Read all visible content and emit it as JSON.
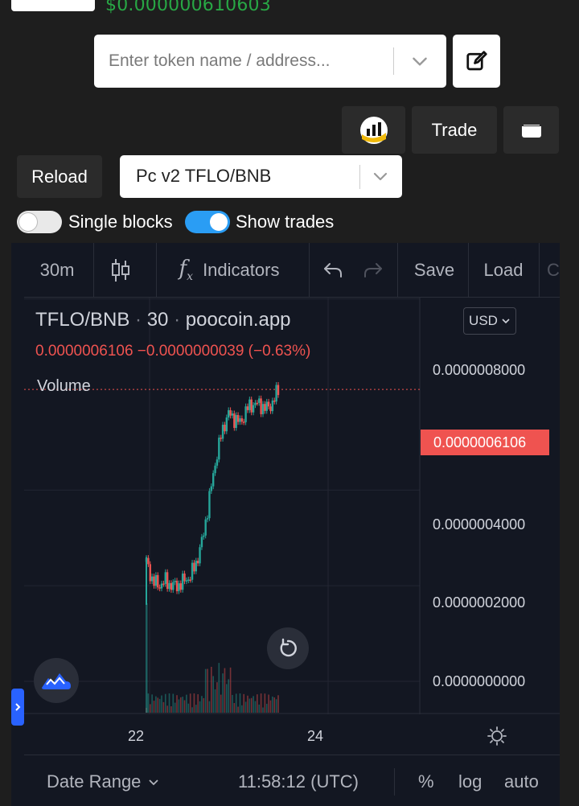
{
  "header": {
    "price": "$0.000000610603"
  },
  "search": {
    "placeholder": "Enter token name / address..."
  },
  "actions": {
    "trade_label": "Trade",
    "reload_label": "Reload"
  },
  "pair_select": {
    "value": "Pc v2 TFLO/BNB"
  },
  "toggles": [
    {
      "label": "Single blocks",
      "on": false
    },
    {
      "label": "Show trades",
      "on": true
    }
  ],
  "toolbar": {
    "interval": "30m",
    "indicators_label": "Indicators",
    "save_label": "Save",
    "load_label": "Load",
    "overflow_label": "C"
  },
  "legend": {
    "pair": "TFLO/BNB",
    "interval": "30",
    "source": "poocoin.app",
    "close": "0.0000006106",
    "change": "−0.0000000039 (−0.63%)",
    "volume_label": "Volume"
  },
  "currency_button": "USD",
  "chart_data": {
    "type": "candlestick",
    "series_name": "TFLO/BNB",
    "current_price": "0.0000006106",
    "y_ticks": [
      "0.0000008000",
      "0.0000006106",
      "0.0000004000",
      "0.0000002000",
      "0.0000000000"
    ],
    "y_tick_values": [
      8e-07,
      6.106e-07,
      4e-07,
      2e-07,
      0.0
    ],
    "x_ticks": [
      "22",
      "24"
    ],
    "ylim": [
      0,
      8.7e-07
    ],
    "price_path": [
      2.5e-07,
      2.1e-07,
      2e-07,
      2.1e-07,
      2e-07,
      2e-07,
      2.1e-07,
      2.2e-07,
      2.5e-07,
      3e-07,
      3.8e-07,
      4.6e-07,
      5.2e-07,
      5.6e-07,
      5.5e-07,
      5.4e-07,
      5.7e-07,
      5.8e-07,
      5.8e-07,
      5.7e-07,
      5.8e-07,
      6.1e-07
    ]
  },
  "bottom_bar": {
    "date_range_label": "Date Range",
    "time": "11:58:12 (UTC)",
    "percent_label": "%",
    "log_label": "log",
    "auto_label": "auto"
  },
  "colors": {
    "up": "#26a69a",
    "down": "#ef5350",
    "accent": "#2962ff",
    "price_green": "#28a745",
    "chart_bg": "#131722"
  },
  "icons": [
    "pencil-square-icon",
    "chart-logo-icon",
    "wallet-icon",
    "chevron-down-icon",
    "candles-icon",
    "function-icon",
    "undo-icon",
    "redo-icon",
    "reset-icon",
    "tradingview-logo-icon",
    "settings-icon"
  ]
}
